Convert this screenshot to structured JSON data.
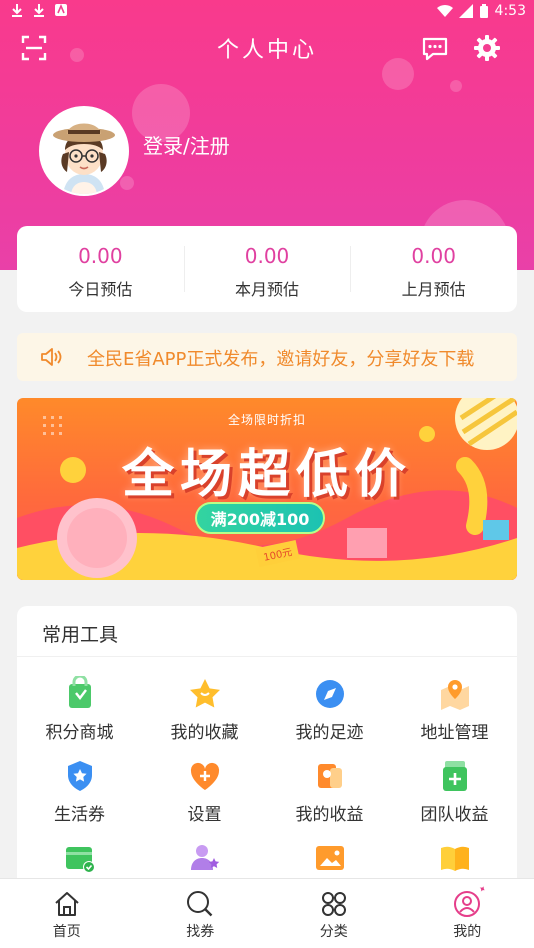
{
  "status_bar": {
    "time": "4:53"
  },
  "header": {
    "title": "个人中心"
  },
  "profile": {
    "login_label": "登录/注册"
  },
  "stats": [
    {
      "value": "0.00",
      "label": "今日预估"
    },
    {
      "value": "0.00",
      "label": "本月预估"
    },
    {
      "value": "0.00",
      "label": "上月预估"
    }
  ],
  "notice": {
    "text": "全民E省APP正式发布，邀请好友，分享好友下载"
  },
  "banner": {
    "subtitle": "全场限时折扣",
    "title": "全场超低价",
    "promo": "满200减100",
    "tag": "100元"
  },
  "tools": {
    "title": "常用工具",
    "items": [
      {
        "label": "积分商城",
        "icon": "bag-icon"
      },
      {
        "label": "我的收藏",
        "icon": "star-icon"
      },
      {
        "label": "我的足迹",
        "icon": "compass-icon"
      },
      {
        "label": "地址管理",
        "icon": "location-icon"
      },
      {
        "label": "生活券",
        "icon": "shield-star-icon"
      },
      {
        "label": "设置",
        "icon": "heart-plus-icon"
      },
      {
        "label": "我的收益",
        "icon": "money-bag-icon"
      },
      {
        "label": "团队收益",
        "icon": "wallet-plus-icon"
      },
      {
        "label": "",
        "icon": "calendar-check-icon"
      },
      {
        "label": "",
        "icon": "user-star-icon"
      },
      {
        "label": "",
        "icon": "image-icon"
      },
      {
        "label": "",
        "icon": "book-icon"
      }
    ]
  },
  "tabbar": [
    {
      "label": "首页",
      "icon": "home-icon"
    },
    {
      "label": "找券",
      "icon": "search-icon"
    },
    {
      "label": "分类",
      "icon": "category-icon"
    },
    {
      "label": "我的",
      "icon": "profile-icon"
    }
  ],
  "colors": {
    "accent": "#e940a0",
    "notice_text": "#f08a2c",
    "banner": "#ff7a34"
  }
}
